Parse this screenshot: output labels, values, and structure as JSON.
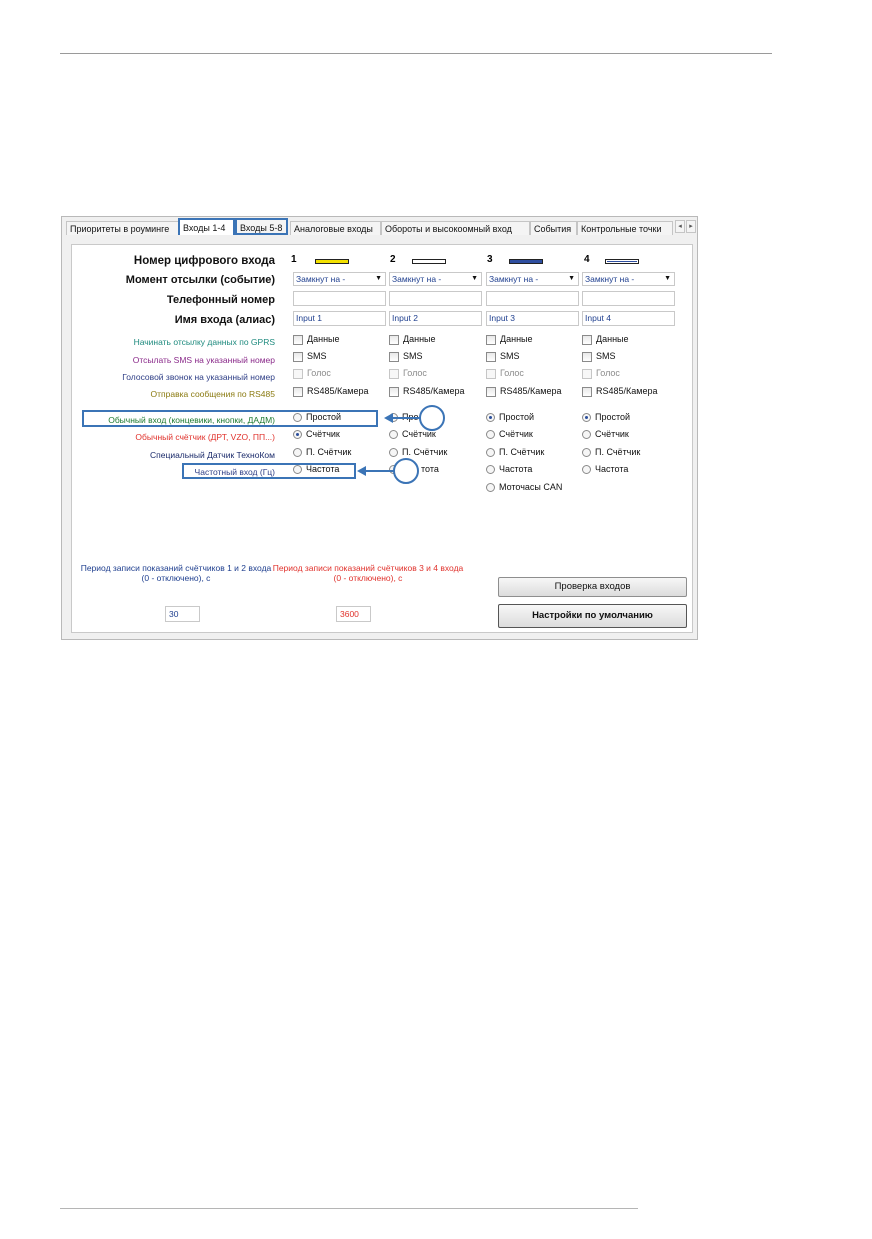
{
  "tabs": [
    {
      "label": "Приоритеты в роуминге"
    },
    {
      "label": "Входы 1-4"
    },
    {
      "label": "Входы 5-8"
    },
    {
      "label": "Аналоговые входы"
    },
    {
      "label": "Обороты и высокоомный вход"
    },
    {
      "label": "События"
    },
    {
      "label": "Контрольные точки"
    }
  ],
  "tab_scroll": {
    "left": "◂",
    "right": "▸"
  },
  "row_labels": {
    "input_number": "Номер цифрового входа",
    "send_moment": "Момент отсылки (событие)",
    "phone": "Телефонный номер",
    "alias": "Имя входа (алиас)",
    "gprs": "Начинать отсылку данных по GPRS",
    "sms": "Отсылать SMS на указанный номер",
    "voice": "Голосовой звонок на указанный номер",
    "rs485": "Отправка сообщения по RS485",
    "normal": "Обычный вход (концевики, кнопки, ДАДМ)",
    "counter": "Обычный счётчик (ДРТ, VZO, ПП...)",
    "special": "Специальный Датчик ТехноКом",
    "freq": "Частотный вход (Гц)"
  },
  "row_label_colors": {
    "gprs": "#1e8a7e",
    "sms": "#8a2a8a",
    "voice": "#2e3e86",
    "rs485": "#8a7a10",
    "normal": "#1e7a30",
    "counter": "#e0322c",
    "special": "#1a2a6a",
    "freq": "#2e3e86"
  },
  "columns": [
    {
      "num": "1",
      "color": "#f2e000",
      "event": "Замкнут на -",
      "phone": "",
      "alias": "Input 1",
      "gprs": "Данные",
      "sms": "SMS",
      "voice": "Голос",
      "rs485": "RS485/Камера",
      "mode": "Счётчик"
    },
    {
      "num": "2",
      "color": "#ffffff",
      "event": "Замкнут на -",
      "phone": "",
      "alias": "Input 2",
      "gprs": "Данные",
      "sms": "SMS",
      "voice": "Голос",
      "rs485": "RS485/Камера",
      "mode": "none"
    },
    {
      "num": "3",
      "color": "#2e4ea0",
      "event": "Замкнут на -",
      "phone": "",
      "alias": "Input 3",
      "gprs": "Данные",
      "sms": "SMS",
      "voice": "Голос",
      "rs485": "RS485/Камера",
      "mode": "Простой"
    },
    {
      "num": "4",
      "color": "#2e4ea0",
      "event": "Замкнут на -",
      "phone": "",
      "alias": "Input 4",
      "gprs": "Данные",
      "sms": "SMS",
      "voice": "Голос",
      "rs485": "RS485/Камера",
      "mode": "Простой"
    }
  ],
  "radio_options": {
    "col1": [
      "Простой",
      "Счётчик",
      "П. Счётчик",
      "Частота"
    ],
    "col2": [
      "Про",
      "Счётчик",
      "П. Счётчик",
      "тота"
    ],
    "col3": [
      "Простой",
      "Счётчик",
      "П. Счётчик",
      "Частота",
      "Моточасы CAN"
    ],
    "col4": [
      "Простой",
      "Счётчик",
      "П. Счётчик",
      "Частота"
    ]
  },
  "period_12": {
    "label": "Период записи показаний счётчиков 1 и 2 входа (0 - отключено), с",
    "value": "30",
    "color": "#1f3f8f"
  },
  "period_34": {
    "label": "Период записи показаний счётчиков 3 и 4 входа (0 - отключено), с",
    "value": "3600",
    "color": "#e0322c"
  },
  "buttons": {
    "check": "Проверка входов",
    "defaults": "Настройки по умолчанию"
  },
  "annotation_color": "#3b74b6"
}
